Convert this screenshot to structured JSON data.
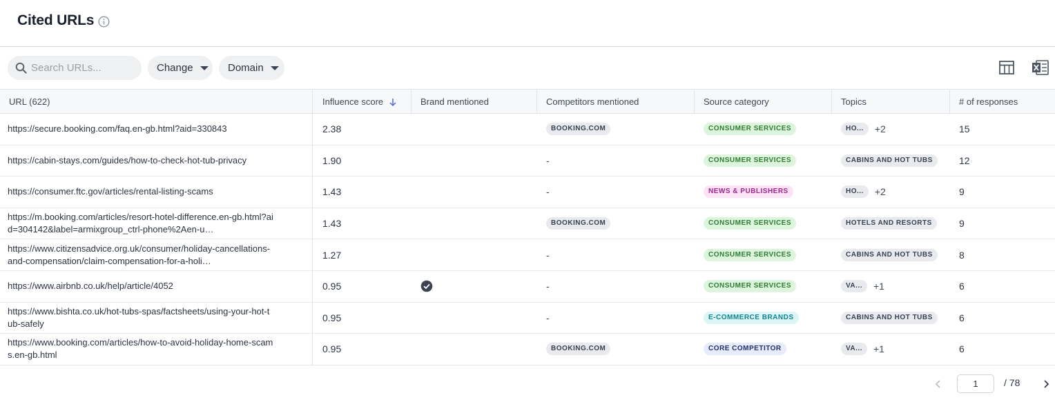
{
  "header": {
    "title": "Cited URLs",
    "info_icon": "info-icon"
  },
  "toolbar": {
    "search_placeholder": "Search URLs...",
    "filters": [
      "Change",
      "Domain"
    ],
    "icons": [
      "table-icon",
      "excel-export-icon"
    ]
  },
  "table": {
    "columns": [
      "URL (622)",
      "Influence score",
      "Brand mentioned",
      "Competitors mentioned",
      "Source category",
      "Topics",
      "# of responses"
    ],
    "sort_column": "Influence score",
    "sort_direction": "descending",
    "rows": [
      {
        "url": "https://secure.booking.com/faq.en-gb.html?aid=330843",
        "score": "2.38",
        "brand": false,
        "competitor": "BOOKING.COM",
        "category": "CONSUMER SERVICES",
        "category_style": "green",
        "topic": "HO...",
        "topic_more": "+2",
        "responses": "15"
      },
      {
        "url": "https://cabin-stays.com/guides/how-to-check-hot-tub-privacy",
        "score": "1.90",
        "brand": false,
        "competitor": "-",
        "category": "CONSUMER SERVICES",
        "category_style": "green",
        "topic": "CABINS AND HOT TUBS",
        "topic_more": "",
        "responses": "12"
      },
      {
        "url": "https://consumer.ftc.gov/articles/rental-listing-scams",
        "score": "1.43",
        "brand": false,
        "competitor": "-",
        "category": "NEWS & PUBLISHERS",
        "category_style": "pink",
        "topic": "HO...",
        "topic_more": "+2",
        "responses": "9"
      },
      {
        "url": "https://m.booking.com/articles/resort-hotel-difference.en-gb.html?aid=304142&label=armixgroup_ctrl-phone%2Aen-u…",
        "score": "1.43",
        "brand": false,
        "competitor": "BOOKING.COM",
        "category": "CONSUMER SERVICES",
        "category_style": "green",
        "topic": "HOTELS AND RESORTS",
        "topic_more": "",
        "responses": "9"
      },
      {
        "url": "https://www.citizensadvice.org.uk/consumer/holiday-cancellations-and-compensation/claim-compensation-for-a-holi…",
        "score": "1.27",
        "brand": false,
        "competitor": "-",
        "category": "CONSUMER SERVICES",
        "category_style": "green",
        "topic": "CABINS AND HOT TUBS",
        "topic_more": "",
        "responses": "8"
      },
      {
        "url": "https://www.airbnb.co.uk/help/article/4052",
        "score": "0.95",
        "brand": true,
        "competitor": "-",
        "category": "CONSUMER SERVICES",
        "category_style": "green",
        "topic": "VA...",
        "topic_more": "+1",
        "responses": "6"
      },
      {
        "url": "https://www.bishta.co.uk/hot-tubs-spas/factsheets/using-your-hot-tub-safely",
        "score": "0.95",
        "brand": false,
        "competitor": "-",
        "category": "E-COMMERCE BRANDS",
        "category_style": "cyan",
        "topic": "CABINS AND HOT TUBS",
        "topic_more": "",
        "responses": "6"
      },
      {
        "url": "https://www.booking.com/articles/how-to-avoid-holiday-home-scams.en-gb.html",
        "score": "0.95",
        "brand": false,
        "competitor": "BOOKING.COM",
        "category": "CORE COMPETITOR",
        "category_style": "navy",
        "topic": "VA...",
        "topic_more": "+1",
        "responses": "6"
      }
    ]
  },
  "pagination": {
    "current_page": "1",
    "total_label": "/  78"
  }
}
